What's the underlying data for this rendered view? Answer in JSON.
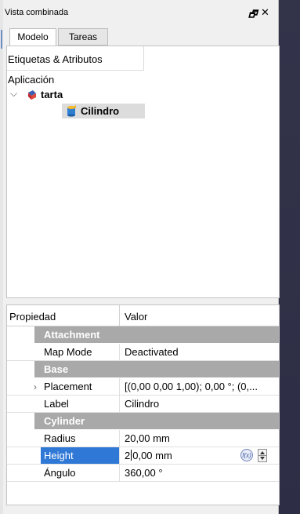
{
  "dock": {
    "title": "Vista combinada",
    "float_glyph": "🗗",
    "close_glyph": "✕"
  },
  "tabs": [
    {
      "label": "Modelo",
      "active": true
    },
    {
      "label": "Tareas",
      "active": false
    }
  ],
  "tree": {
    "header": "Etiquetas & Atributos",
    "app_label": "Aplicación",
    "items": [
      {
        "label": "tarta",
        "icon": "document-icon",
        "expanded": true
      },
      {
        "label": "Cilindro",
        "icon": "cylinder-icon",
        "selected": true
      }
    ]
  },
  "properties": {
    "col_property": "Propiedad",
    "col_value": "Valor",
    "groups": {
      "attachment": "Attachment",
      "base": "Base",
      "cylinder": "Cylinder"
    },
    "rows": {
      "map_mode": {
        "key": "Map Mode",
        "value": "Deactivated"
      },
      "placement": {
        "key": "Placement",
        "value": "[(0,00 0,00 1,00); 0,00 °; (0,..."
      },
      "label": {
        "key": "Label",
        "value": "Cilindro"
      },
      "radius": {
        "key": "Radius",
        "value": "20,00 mm"
      },
      "height": {
        "key": "Height",
        "value_before_caret": "2",
        "value_after_caret": "0,00 mm"
      },
      "angle": {
        "key": "Ángulo",
        "value": "360,00 °"
      }
    },
    "expression_icon_label": "f(x)"
  },
  "colors": {
    "selection_blue": "#2f78d6",
    "group_gray": "#a9a9a9",
    "background_dark": "#2d2d45"
  }
}
